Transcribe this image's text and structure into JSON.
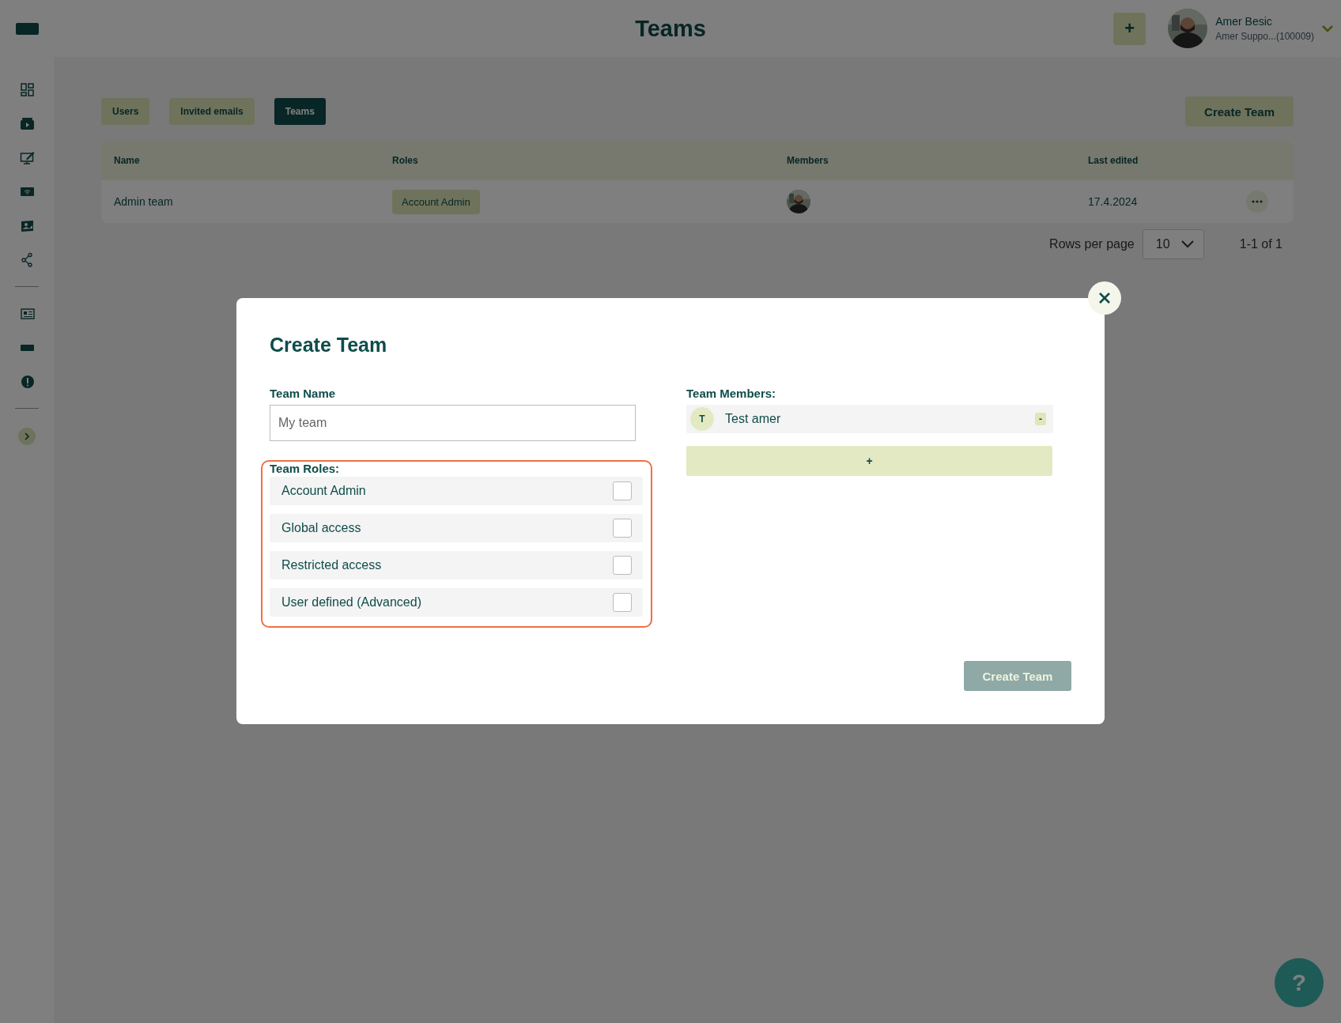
{
  "app": {
    "title": "Teams",
    "add_button": "+"
  },
  "user": {
    "name": "Amer Besic",
    "account": "Amer Suppo...(100009)"
  },
  "tabs": [
    {
      "label": "Users",
      "selected": false
    },
    {
      "label": "Invited emails",
      "selected": false
    },
    {
      "label": "Teams",
      "selected": true
    }
  ],
  "create_button": "Create Team",
  "table": {
    "columns": [
      "Name",
      "Roles",
      "Members",
      "Last edited"
    ],
    "rows": [
      {
        "name": "Admin team",
        "roles": [
          "Account Admin"
        ],
        "last_edited": "17.4.2024"
      }
    ]
  },
  "pagination": {
    "label": "Rows per page",
    "rows_per_page": "10",
    "range": "1-1 of 1"
  },
  "modal": {
    "title": "Create Team",
    "team_name": {
      "label": "Team Name",
      "placeholder": "My team"
    },
    "roles": {
      "label": "Team Roles:",
      "items": [
        {
          "label": "Account Admin",
          "checked": false
        },
        {
          "label": "Global access",
          "checked": false
        },
        {
          "label": "Restricted access",
          "checked": false
        },
        {
          "label": "User defined (Advanced)",
          "checked": false
        }
      ]
    },
    "members": {
      "label": "Team Members:",
      "items": [
        {
          "initial": "T",
          "name": "Test amer",
          "remove": "-"
        }
      ],
      "add": "+"
    },
    "submit": {
      "label": "Create Team",
      "disabled": true
    }
  },
  "help": "?"
}
